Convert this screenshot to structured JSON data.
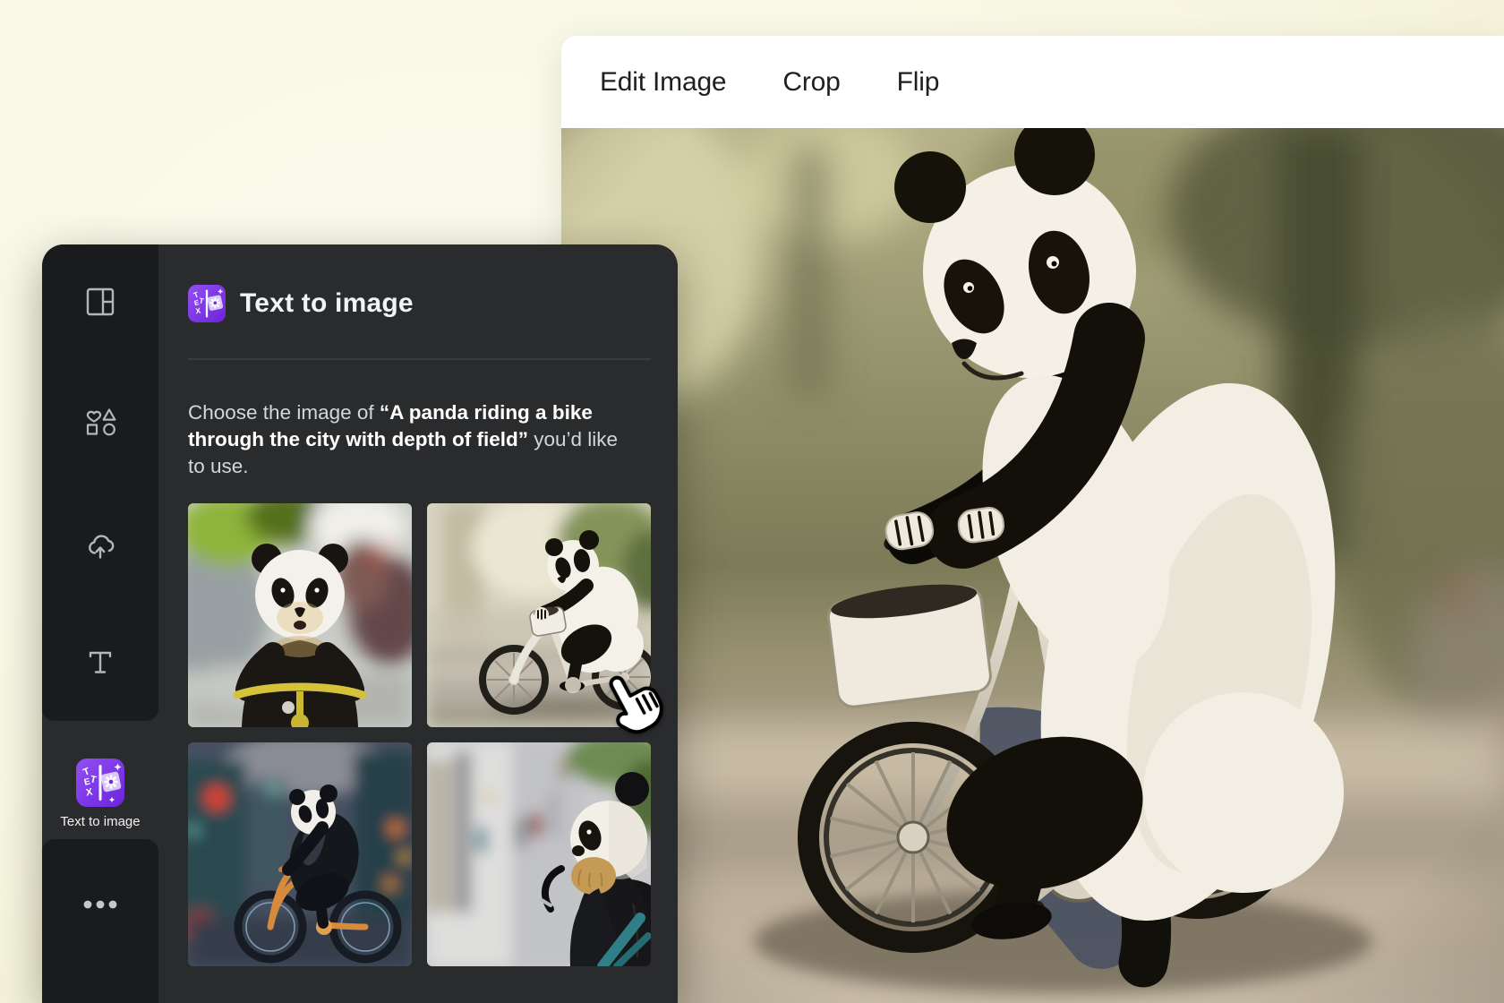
{
  "colors": {
    "background": "#f8f7e3",
    "panel": "#2a2b2d",
    "rail": "#1a1b1c",
    "accent_purple": "#7d2ae8",
    "toolbar_bg": "#ffffff",
    "toolbar_text": "#1f1f21"
  },
  "toolbar": {
    "items": [
      {
        "label": "Edit Image"
      },
      {
        "label": "Crop"
      },
      {
        "label": "Flip"
      }
    ]
  },
  "sidebar": {
    "rail": {
      "items": [
        {
          "name": "design",
          "icon": "layout-template-icon"
        },
        {
          "name": "elements",
          "icon": "shapes-icon"
        },
        {
          "name": "uploads",
          "icon": "cloud-upload-icon"
        },
        {
          "name": "text",
          "icon": "text-icon"
        },
        {
          "name": "text-to-image",
          "icon": "text-to-image-icon",
          "label": "Text to image",
          "active": true
        },
        {
          "name": "more",
          "icon": "ellipsis-icon"
        }
      ]
    },
    "panel": {
      "title": "Text to image",
      "title_icon": "text-to-image-icon",
      "description": {
        "prefix": "Choose the image of ",
        "prompt": "“A panda riding a bike through the city with depth of field”",
        "suffix": " you’d like to use."
      },
      "thumbnails": [
        {
          "alt": "Panda facing forward riding a yellow bicycle on a blurred city street"
        },
        {
          "alt": "Panda riding a white bicycle, side view, on a blurred street with trees"
        },
        {
          "alt": "Panda riding an orange bicycle through a city street at night with red lights"
        },
        {
          "alt": "Close-up of a panda with a teal bicycle on a blurred daytime street"
        }
      ]
    }
  },
  "canvas": {
    "image_alt": "A panda riding a bike through the city with depth of field"
  },
  "cursor": {
    "type": "hand-pointer"
  }
}
